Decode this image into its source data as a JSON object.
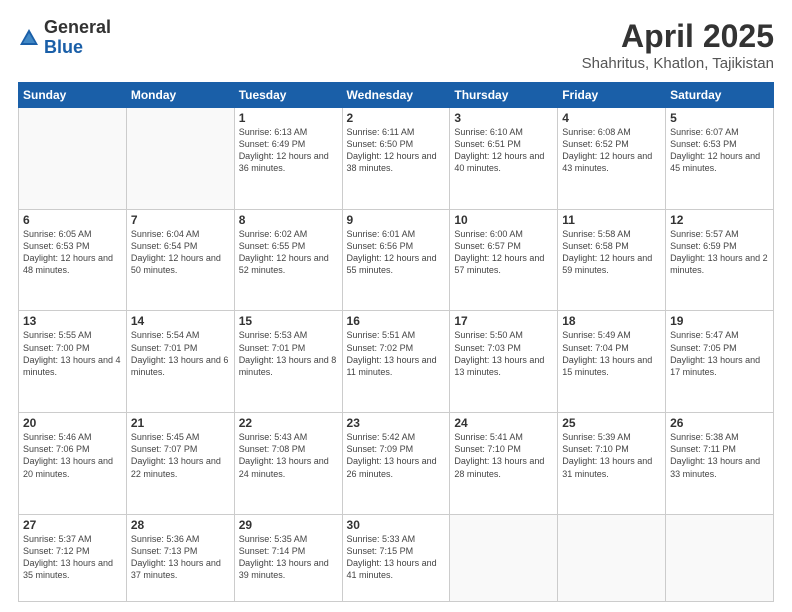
{
  "header": {
    "logo_general": "General",
    "logo_blue": "Blue",
    "title": "April 2025",
    "location": "Shahritus, Khatlon, Tajikistan"
  },
  "weekdays": [
    "Sunday",
    "Monday",
    "Tuesday",
    "Wednesday",
    "Thursday",
    "Friday",
    "Saturday"
  ],
  "weeks": [
    [
      {
        "day": "",
        "info": ""
      },
      {
        "day": "",
        "info": ""
      },
      {
        "day": "1",
        "info": "Sunrise: 6:13 AM\nSunset: 6:49 PM\nDaylight: 12 hours\nand 36 minutes."
      },
      {
        "day": "2",
        "info": "Sunrise: 6:11 AM\nSunset: 6:50 PM\nDaylight: 12 hours\nand 38 minutes."
      },
      {
        "day": "3",
        "info": "Sunrise: 6:10 AM\nSunset: 6:51 PM\nDaylight: 12 hours\nand 40 minutes."
      },
      {
        "day": "4",
        "info": "Sunrise: 6:08 AM\nSunset: 6:52 PM\nDaylight: 12 hours\nand 43 minutes."
      },
      {
        "day": "5",
        "info": "Sunrise: 6:07 AM\nSunset: 6:53 PM\nDaylight: 12 hours\nand 45 minutes."
      }
    ],
    [
      {
        "day": "6",
        "info": "Sunrise: 6:05 AM\nSunset: 6:53 PM\nDaylight: 12 hours\nand 48 minutes."
      },
      {
        "day": "7",
        "info": "Sunrise: 6:04 AM\nSunset: 6:54 PM\nDaylight: 12 hours\nand 50 minutes."
      },
      {
        "day": "8",
        "info": "Sunrise: 6:02 AM\nSunset: 6:55 PM\nDaylight: 12 hours\nand 52 minutes."
      },
      {
        "day": "9",
        "info": "Sunrise: 6:01 AM\nSunset: 6:56 PM\nDaylight: 12 hours\nand 55 minutes."
      },
      {
        "day": "10",
        "info": "Sunrise: 6:00 AM\nSunset: 6:57 PM\nDaylight: 12 hours\nand 57 minutes."
      },
      {
        "day": "11",
        "info": "Sunrise: 5:58 AM\nSunset: 6:58 PM\nDaylight: 12 hours\nand 59 minutes."
      },
      {
        "day": "12",
        "info": "Sunrise: 5:57 AM\nSunset: 6:59 PM\nDaylight: 13 hours\nand 2 minutes."
      }
    ],
    [
      {
        "day": "13",
        "info": "Sunrise: 5:55 AM\nSunset: 7:00 PM\nDaylight: 13 hours\nand 4 minutes."
      },
      {
        "day": "14",
        "info": "Sunrise: 5:54 AM\nSunset: 7:01 PM\nDaylight: 13 hours\nand 6 minutes."
      },
      {
        "day": "15",
        "info": "Sunrise: 5:53 AM\nSunset: 7:01 PM\nDaylight: 13 hours\nand 8 minutes."
      },
      {
        "day": "16",
        "info": "Sunrise: 5:51 AM\nSunset: 7:02 PM\nDaylight: 13 hours\nand 11 minutes."
      },
      {
        "day": "17",
        "info": "Sunrise: 5:50 AM\nSunset: 7:03 PM\nDaylight: 13 hours\nand 13 minutes."
      },
      {
        "day": "18",
        "info": "Sunrise: 5:49 AM\nSunset: 7:04 PM\nDaylight: 13 hours\nand 15 minutes."
      },
      {
        "day": "19",
        "info": "Sunrise: 5:47 AM\nSunset: 7:05 PM\nDaylight: 13 hours\nand 17 minutes."
      }
    ],
    [
      {
        "day": "20",
        "info": "Sunrise: 5:46 AM\nSunset: 7:06 PM\nDaylight: 13 hours\nand 20 minutes."
      },
      {
        "day": "21",
        "info": "Sunrise: 5:45 AM\nSunset: 7:07 PM\nDaylight: 13 hours\nand 22 minutes."
      },
      {
        "day": "22",
        "info": "Sunrise: 5:43 AM\nSunset: 7:08 PM\nDaylight: 13 hours\nand 24 minutes."
      },
      {
        "day": "23",
        "info": "Sunrise: 5:42 AM\nSunset: 7:09 PM\nDaylight: 13 hours\nand 26 minutes."
      },
      {
        "day": "24",
        "info": "Sunrise: 5:41 AM\nSunset: 7:10 PM\nDaylight: 13 hours\nand 28 minutes."
      },
      {
        "day": "25",
        "info": "Sunrise: 5:39 AM\nSunset: 7:10 PM\nDaylight: 13 hours\nand 31 minutes."
      },
      {
        "day": "26",
        "info": "Sunrise: 5:38 AM\nSunset: 7:11 PM\nDaylight: 13 hours\nand 33 minutes."
      }
    ],
    [
      {
        "day": "27",
        "info": "Sunrise: 5:37 AM\nSunset: 7:12 PM\nDaylight: 13 hours\nand 35 minutes."
      },
      {
        "day": "28",
        "info": "Sunrise: 5:36 AM\nSunset: 7:13 PM\nDaylight: 13 hours\nand 37 minutes."
      },
      {
        "day": "29",
        "info": "Sunrise: 5:35 AM\nSunset: 7:14 PM\nDaylight: 13 hours\nand 39 minutes."
      },
      {
        "day": "30",
        "info": "Sunrise: 5:33 AM\nSunset: 7:15 PM\nDaylight: 13 hours\nand 41 minutes."
      },
      {
        "day": "",
        "info": ""
      },
      {
        "day": "",
        "info": ""
      },
      {
        "day": "",
        "info": ""
      }
    ]
  ]
}
